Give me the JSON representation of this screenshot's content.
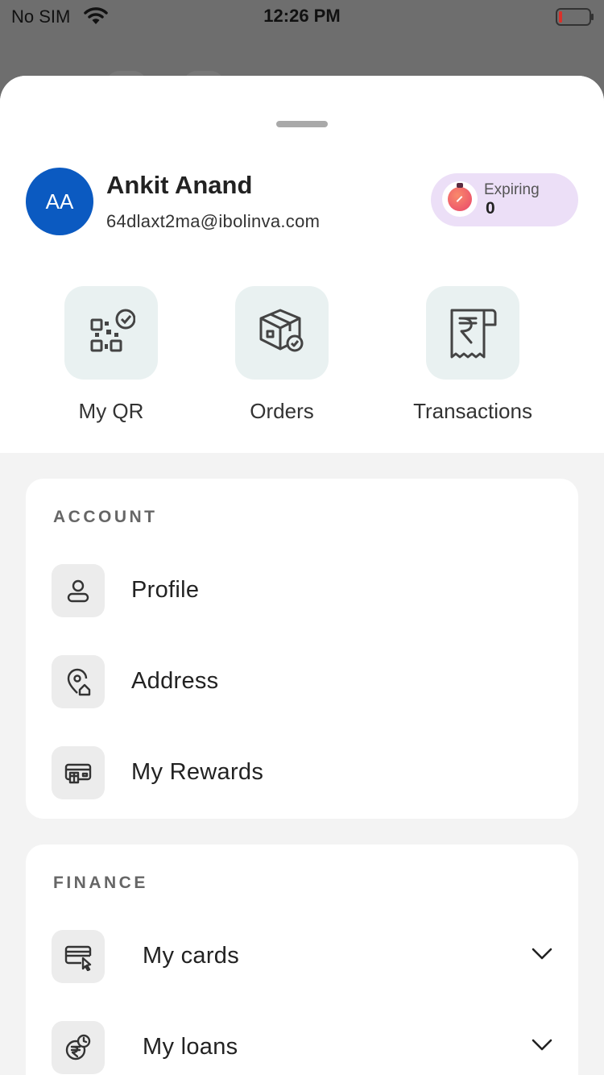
{
  "status_bar": {
    "carrier": "No SIM",
    "time": "12:26 PM"
  },
  "profile": {
    "initials": "AA",
    "name": "Ankit Anand",
    "email": "64dlaxt2ma@ibolinva.com",
    "expiring_label": "Expiring",
    "expiring_value": "0"
  },
  "quick_actions": [
    {
      "label": "My QR",
      "icon": "qr-code-icon"
    },
    {
      "label": "Orders",
      "icon": "package-box-icon"
    },
    {
      "label": "Transactions",
      "icon": "rupee-receipt-icon"
    }
  ],
  "account": {
    "title": "ACCOUNT",
    "items": [
      {
        "label": "Profile",
        "icon": "user-icon"
      },
      {
        "label": "Address",
        "icon": "location-home-icon"
      },
      {
        "label": "My Rewards",
        "icon": "gift-card-icon"
      }
    ]
  },
  "finance": {
    "title": "FINANCE",
    "items": [
      {
        "label": "My cards",
        "icon": "card-pointer-icon"
      },
      {
        "label": "My loans",
        "icon": "rupee-clock-icon"
      }
    ]
  },
  "colors": {
    "avatar": "#0b5ac1",
    "expiring_pill": "#ecdff7",
    "tile_bg": "#e9f1f1"
  }
}
